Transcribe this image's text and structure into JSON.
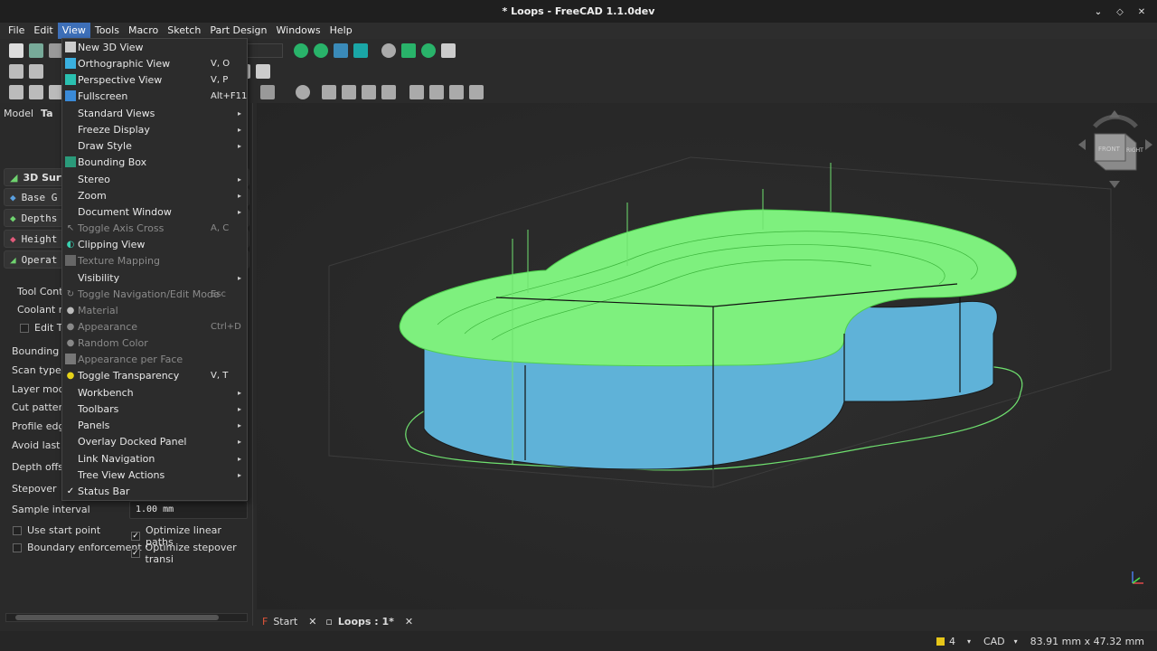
{
  "window": {
    "title": "* Loops - FreeCAD 1.1.0dev"
  },
  "menubar": [
    "File",
    "Edit",
    "View",
    "Tools",
    "Macro",
    "Sketch",
    "Part Design",
    "Windows",
    "Help"
  ],
  "view_menu": [
    {
      "label": "New 3D View",
      "shortcut": "",
      "submenu": false,
      "disabled": false,
      "icon": "new-3d-view-icon"
    },
    {
      "label": "Orthographic View",
      "shortcut": "V, O",
      "submenu": false,
      "disabled": false,
      "icon": "orthographic-icon"
    },
    {
      "label": "Perspective View",
      "shortcut": "V, P",
      "submenu": false,
      "disabled": false,
      "icon": "perspective-icon"
    },
    {
      "label": "Fullscreen",
      "shortcut": "Alt+F11",
      "submenu": false,
      "disabled": false,
      "icon": "fullscreen-icon"
    },
    {
      "label": "Standard Views",
      "shortcut": "",
      "submenu": true,
      "disabled": false,
      "icon": ""
    },
    {
      "label": "Freeze Display",
      "shortcut": "",
      "submenu": true,
      "disabled": false,
      "icon": ""
    },
    {
      "label": "Draw Style",
      "shortcut": "",
      "submenu": true,
      "disabled": false,
      "icon": ""
    },
    {
      "label": "Bounding Box",
      "shortcut": "",
      "submenu": false,
      "disabled": false,
      "icon": "bounding-box-icon"
    },
    {
      "label": "Stereo",
      "shortcut": "",
      "submenu": true,
      "disabled": false,
      "icon": ""
    },
    {
      "label": "Zoom",
      "shortcut": "",
      "submenu": true,
      "disabled": false,
      "icon": ""
    },
    {
      "label": "Document Window",
      "shortcut": "",
      "submenu": true,
      "disabled": false,
      "icon": ""
    },
    {
      "label": "Toggle Axis Cross",
      "shortcut": "A, C",
      "submenu": false,
      "disabled": true,
      "icon": "axis-cross-icon"
    },
    {
      "label": "Clipping View",
      "shortcut": "",
      "submenu": false,
      "disabled": false,
      "icon": "clipping-view-icon"
    },
    {
      "label": "Texture Mapping",
      "shortcut": "",
      "submenu": false,
      "disabled": true,
      "icon": "texture-icon"
    },
    {
      "label": "Visibility",
      "shortcut": "",
      "submenu": true,
      "disabled": false,
      "icon": ""
    },
    {
      "label": "Toggle Navigation/Edit Mode",
      "shortcut": "Esc",
      "submenu": false,
      "disabled": true,
      "icon": "nav-edit-icon"
    },
    {
      "label": "Material",
      "shortcut": "",
      "submenu": false,
      "disabled": true,
      "icon": "material-icon"
    },
    {
      "label": "Appearance",
      "shortcut": "Ctrl+D",
      "submenu": false,
      "disabled": true,
      "icon": "appearance-icon"
    },
    {
      "label": "Random Color",
      "shortcut": "",
      "submenu": false,
      "disabled": true,
      "icon": "random-color-icon"
    },
    {
      "label": "Appearance per Face",
      "shortcut": "",
      "submenu": false,
      "disabled": true,
      "icon": "appearance-face-icon"
    },
    {
      "label": "Toggle Transparency",
      "shortcut": "V, T",
      "submenu": false,
      "disabled": false,
      "icon": "transparency-icon"
    },
    {
      "label": "Workbench",
      "shortcut": "",
      "submenu": true,
      "disabled": false,
      "icon": ""
    },
    {
      "label": "Toolbars",
      "shortcut": "",
      "submenu": true,
      "disabled": false,
      "icon": ""
    },
    {
      "label": "Panels",
      "shortcut": "",
      "submenu": true,
      "disabled": false,
      "icon": ""
    },
    {
      "label": "Overlay Docked Panel",
      "shortcut": "",
      "submenu": true,
      "disabled": false,
      "icon": ""
    },
    {
      "label": "Link Navigation",
      "shortcut": "",
      "submenu": true,
      "disabled": false,
      "icon": ""
    },
    {
      "label": "Tree View Actions",
      "shortcut": "",
      "submenu": true,
      "disabled": false,
      "icon": ""
    },
    {
      "label": "Status Bar",
      "shortcut": "",
      "submenu": false,
      "disabled": false,
      "icon": "check-icon"
    }
  ],
  "panel": {
    "tab_model": "Model",
    "tab_tasks": "Ta",
    "task_title": "3D Surfa",
    "sections": [
      "Base G",
      "Depths",
      "Height",
      "Operat"
    ],
    "labels": [
      "Tool Contr",
      "Coolant m",
      "Edit To",
      "Bounding b",
      "Scan type",
      "Layer mode",
      "Cut pattern",
      "Profile edge",
      "Avoid last X",
      "Depth offse",
      "Stepover"
    ],
    "sample_interval_label": "Sample interval",
    "sample_interval_value": "1.00 mm",
    "use_start_point": "Use start point",
    "optimize_linear": "Optimize linear paths",
    "boundary_enforcement": "Boundary enforcement",
    "optimize_stepover": "Optimize stepover transi"
  },
  "doc_tabs": [
    {
      "label": "Start"
    },
    {
      "label": "Loops : 1*"
    }
  ],
  "statusbar": {
    "count": "4",
    "nav_style": "CAD",
    "dimensions": "83.91 mm x 47.32 mm"
  },
  "navcube": {
    "face": "FRONT",
    "side": "RIGHT"
  }
}
